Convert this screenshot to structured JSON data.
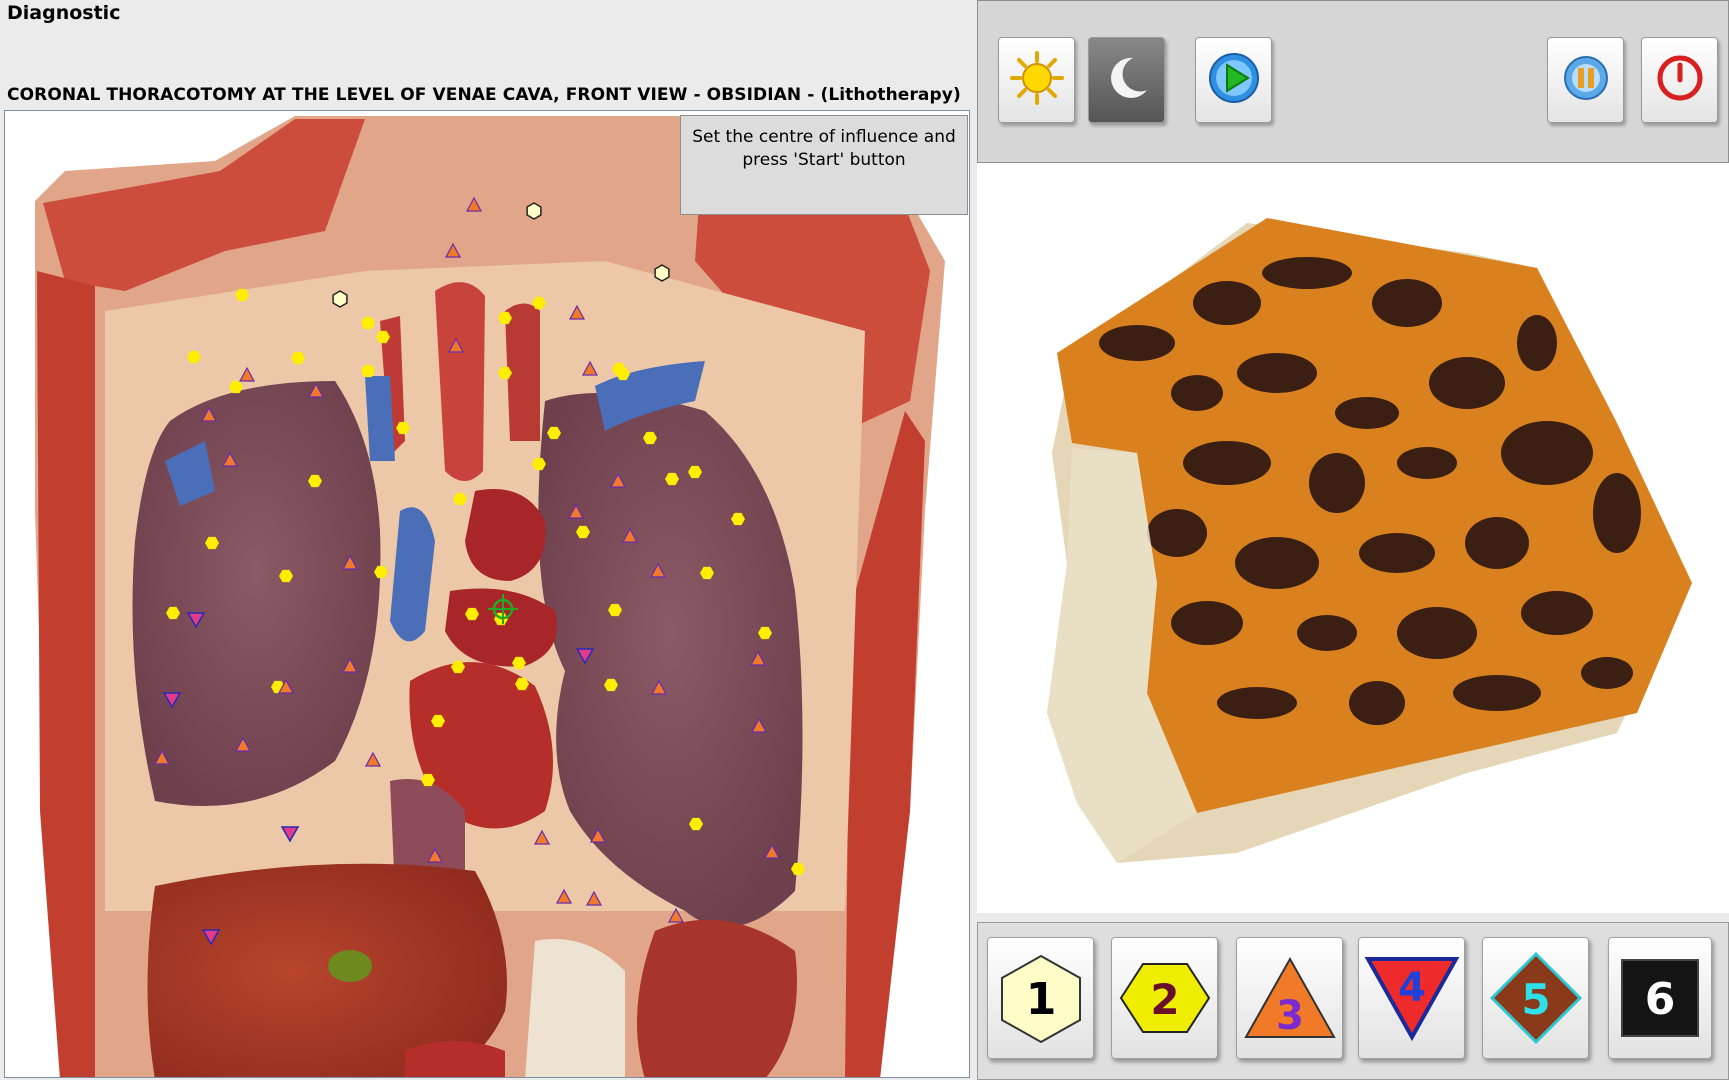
{
  "window": {
    "title": "Diagnostic"
  },
  "image": {
    "caption": "CORONAL THORACOTOMY AT THE LEVEL OF VENAE CAVA, FRONT VIEW - OBSIDIAN - (Lithotherapy)"
  },
  "hint": {
    "line1": "Set the centre of influence and",
    "line2": "press 'Start' button"
  },
  "toolbar": {
    "buttons": [
      {
        "name": "day-mode",
        "icon": "sun-icon"
      },
      {
        "name": "night-mode",
        "icon": "moon-icon"
      },
      {
        "name": "start",
        "icon": "play-icon"
      },
      {
        "name": "pause",
        "icon": "pause-icon"
      },
      {
        "name": "power",
        "icon": "power-icon"
      }
    ]
  },
  "legend": {
    "buttons": [
      {
        "label": "1",
        "shape": "hexagon",
        "fill": "#fffcc8",
        "text_color": "#000000"
      },
      {
        "label": "2",
        "shape": "hexagon",
        "fill": "#f0ee00",
        "text_color": "#6a0f2a"
      },
      {
        "label": "3",
        "shape": "triangle",
        "fill": "#f07a28",
        "text_color": "#7a2ad0"
      },
      {
        "label": "4",
        "shape": "inverted-triangle",
        "fill": "#ee2a2a",
        "text_color": "#2040d8"
      },
      {
        "label": "5",
        "shape": "diamond",
        "fill": "#8a3a1a",
        "text_color": "#30e0e8"
      },
      {
        "label": "6",
        "shape": "square",
        "fill": "#141414",
        "text_color": "#ffffff"
      }
    ]
  },
  "colors": {
    "marker_hex": "#ffee00",
    "marker_triangle": "#f07a28",
    "marker_inverted": "#e03a8a",
    "target": "#22aa22"
  }
}
